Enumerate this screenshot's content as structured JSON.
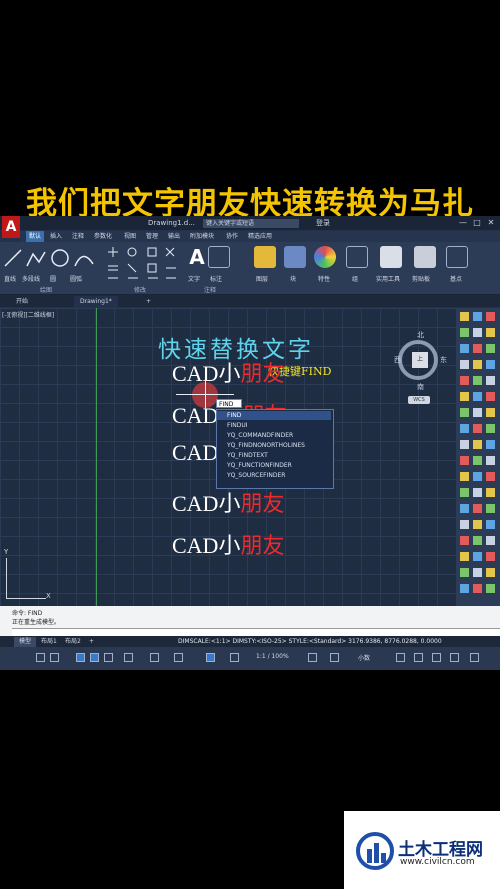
{
  "caption": "我们把文字朋友快速转换为马扎",
  "app": {
    "logo": "A",
    "doc_title": "Drawing1.d...",
    "search_placeholder": "键入关键字或短语",
    "login": "登录",
    "window_buttons": [
      "—",
      "□",
      "✕"
    ],
    "menu": [
      "默认",
      "插入",
      "注释",
      "参数化",
      "视图",
      "管理",
      "输出",
      "附加模块",
      "协作",
      "精选应用"
    ],
    "ribbon": {
      "draw_tools": [
        "直线",
        "多段线",
        "圆",
        "圆弧"
      ],
      "groups": [
        "绘图",
        "修改",
        "注释"
      ],
      "big_buttons": [
        "文字",
        "标注",
        "图层",
        "块",
        "特性",
        "组",
        "实用工具",
        "剪贴板",
        "基点"
      ]
    },
    "file_tabs": [
      "开始",
      "Drawing1*",
      "+"
    ],
    "view_label": "[-][俯视][二维线框]",
    "drawing": {
      "heading": "快速替换文字",
      "shortcut": "快捷键FIND",
      "rows": [
        {
          "black": "CAD小",
          "red": "朋友"
        },
        {
          "black": "CAD",
          "red": "朋友"
        },
        {
          "black": "CAD",
          "red": ""
        },
        {
          "black": "CAD小",
          "red": "朋友"
        },
        {
          "black": "CAD小",
          "red": "朋友"
        }
      ],
      "ucs_x": "X",
      "ucs_y": "Y"
    },
    "autocomplete": {
      "typed": "FIND",
      "items": [
        "FIND",
        "FINDUI",
        "YQ_COMMANDFINDER",
        "YQ_FINDNONORTHOLINES",
        "YQ_FINDTEXT",
        "YQ_FUNCTIONFINDER",
        "YQ_SOURCEFINDER"
      ],
      "selected_index": 0
    },
    "viewcube": {
      "north": "北",
      "south": "南",
      "east": "东",
      "west": "西",
      "face": "上",
      "wcs": "WCS"
    },
    "command": {
      "line1": "命令: FIND",
      "line2": "正在重生成模型。"
    },
    "layout_tabs": [
      "模型",
      "布局1",
      "布局2",
      "+"
    ],
    "dim_status": "DIMSCALE:<1:1> DIMSTY:<ISO-25> STYLE:<Standard> 3176.9386, 8776.0288, 0.0000",
    "statusbar": {
      "scale": "1:1 / 100%",
      "unit": "小数"
    }
  },
  "watermark": {
    "name": "土木工程网",
    "url": "www.civilcn.com"
  },
  "colors": {
    "heading": "#5ed4ea",
    "shortcut": "#f3e42a",
    "red_text": "#ee2a2a",
    "caption": "#f5c400"
  }
}
